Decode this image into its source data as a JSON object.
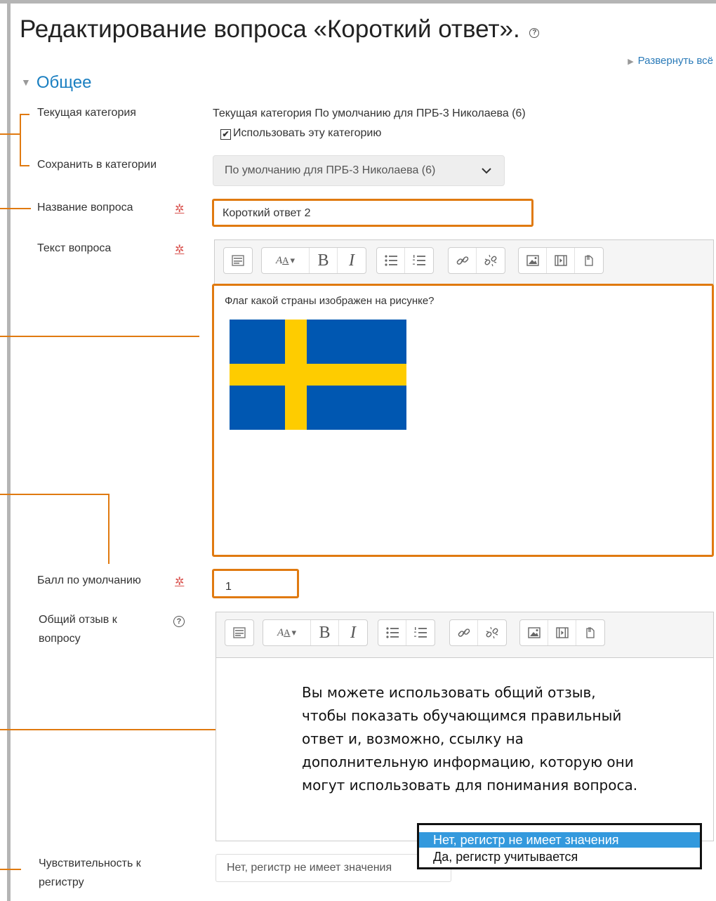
{
  "page": {
    "title": "Редактирование вопроса «Короткий ответ».",
    "help_icon": "?",
    "expand_all": "Развернуть всё",
    "section_general": "Общее"
  },
  "icons": {
    "section_toggle": "triangle-down-icon",
    "expand": "triangle-right-icon",
    "required": "asterisk-icon",
    "help": "question-circle-icon",
    "select_chevron": "chevron-down-icon"
  },
  "colors": {
    "annotation": "#e07a10",
    "link": "#1a7fc1",
    "required": "#d9534f",
    "dropdown_selected": "#3399dd",
    "flag_blue": "#0057b1",
    "flag_yellow": "#fecc00"
  },
  "fields": {
    "current_category": {
      "label": "Текущая категория",
      "value": "Текущая категория По умолчанию для ПРБ-3 Николаева (6)",
      "checkbox_label": "Использовать эту категорию",
      "checkbox_mark": "✔"
    },
    "save_category": {
      "label": "Сохранить в категории",
      "value": "По умолчанию для ПРБ-3 Николаева (6)"
    },
    "question_name": {
      "label": "Название вопроса",
      "value": "Короткий ответ 2"
    },
    "question_text": {
      "label": "Текст вопроса",
      "content": "Флаг какой страны изображен на рисунке?"
    },
    "default_mark": {
      "label": "Балл по умолчанию",
      "value": "1"
    },
    "general_feedback": {
      "label_line1": "Общий отзыв к",
      "label_line2": "вопросу",
      "tip_lines": [
        "Вы можете использовать общий отзыв,",
        "чтобы показать обучающимся правильный",
        "ответ и, возможно, ссылку на",
        "дополнительную информацию, которую они",
        "могут использовать для понимания вопроса."
      ]
    },
    "case_sensitivity": {
      "label_line1": "Чувствительность к",
      "label_line2": "регистру",
      "value": "Нет, регистр не имеет значения",
      "options": [
        "Нет, регистр не имеет значения",
        "Да, регистр учитывается"
      ]
    }
  },
  "toolbar": {
    "bold": "B",
    "italic": "I",
    "font_size": "A",
    "font_size_sub": "A",
    "dropdown_arrow": "▾"
  },
  "required_mark": "✲"
}
